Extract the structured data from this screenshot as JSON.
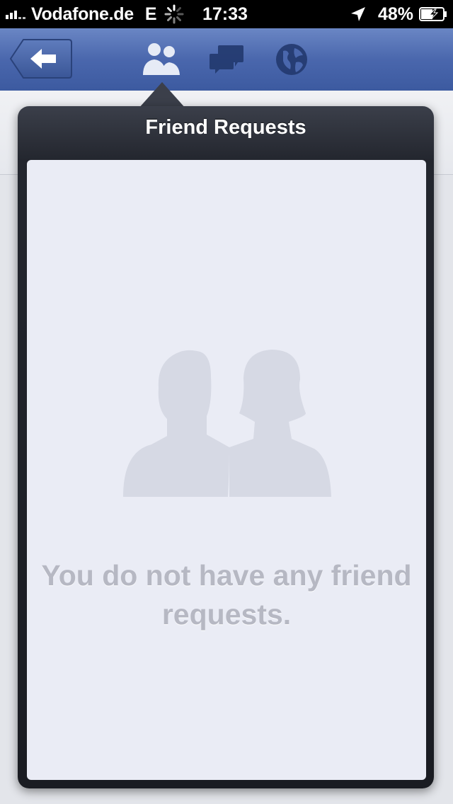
{
  "status_bar": {
    "carrier": "Vodafone.de",
    "network": "E",
    "time": "17:33",
    "battery_percent": "48%",
    "icons": [
      "signal-icon",
      "spinner-icon",
      "location-arrow-icon",
      "battery-charging-icon"
    ]
  },
  "navbar": {
    "icons": [
      "back-arrow-icon",
      "friend-requests-icon",
      "messages-icon",
      "notifications-globe-icon"
    ],
    "active_tab": "friend-requests"
  },
  "popover": {
    "title": "Friend Requests",
    "empty_message": "You do not have any friend requests.",
    "illustration": "two-people-silhouette-icon"
  },
  "colors": {
    "navbar_blue": "#4a67ad",
    "popover_dark": "#1a1c22",
    "content_bg": "#eaecf5",
    "empty_text": "#b6b8c3"
  }
}
